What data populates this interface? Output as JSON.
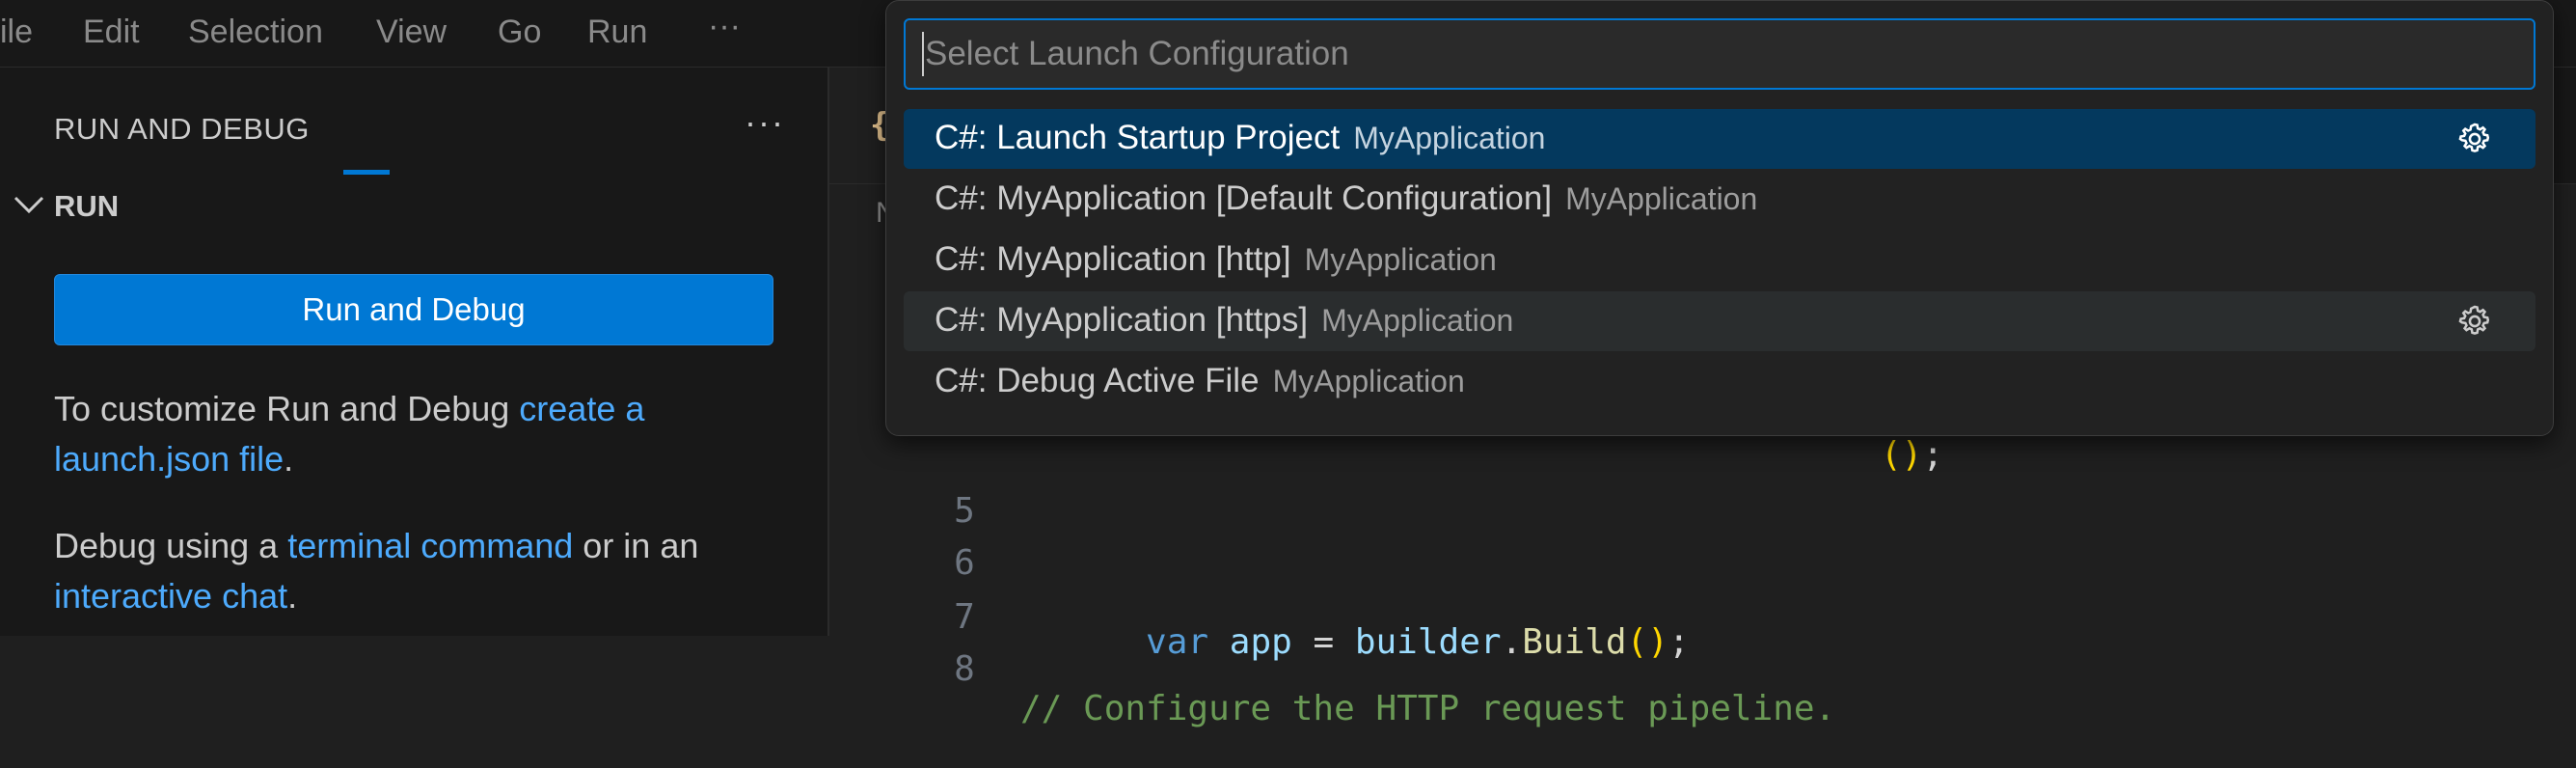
{
  "menubar": {
    "items": [
      "ile",
      "Edit",
      "Selection",
      "View",
      "Go",
      "Run"
    ],
    "more": "···"
  },
  "sidebar": {
    "title": "RUN AND DEBUG",
    "more": "···",
    "section": "RUN",
    "run_button": "Run and Debug",
    "para1": {
      "prefix": "To customize Run and Debug ",
      "link": "create a launch.json file",
      "suffix": "."
    },
    "para2": {
      "prefix": "Debug using a ",
      "link1": "terminal command",
      "middle": " or in an ",
      "link2": "interactive chat",
      "suffix": "."
    }
  },
  "editor": {
    "tab_icon": "{",
    "breadcrumb": "N",
    "lines": [
      {
        "num": "5"
      },
      {
        "num": "6",
        "kw": "var",
        "var": "app",
        "eq": " = ",
        "obj": "builder",
        "dot": ".",
        "fn": "Build",
        "paren": "()",
        "semi": ";"
      },
      {
        "num": "7"
      },
      {
        "num": "8",
        "comment": "// Configure the HTTP request pipeline."
      }
    ],
    "hidden_line_tail": "()"
  },
  "quickpick": {
    "placeholder": "Select Launch Configuration",
    "items": [
      {
        "label": "C#: Launch Startup Project",
        "description": "MyApplication",
        "state": "selected",
        "icon": "gear-icon"
      },
      {
        "label": "C#: MyApplication [Default Configuration]",
        "description": "MyApplication",
        "state": "normal"
      },
      {
        "label": "C#: MyApplication [http]",
        "description": "MyApplication",
        "state": "normal"
      },
      {
        "label": "C#: MyApplication [https]",
        "description": "MyApplication",
        "state": "hovered",
        "icon": "gear-icon"
      },
      {
        "label": "C#: Debug Active File",
        "description": "MyApplication",
        "state": "normal"
      }
    ]
  },
  "colors": {
    "accent": "#0078d4",
    "link": "#4daafc",
    "selection": "#04395e"
  }
}
